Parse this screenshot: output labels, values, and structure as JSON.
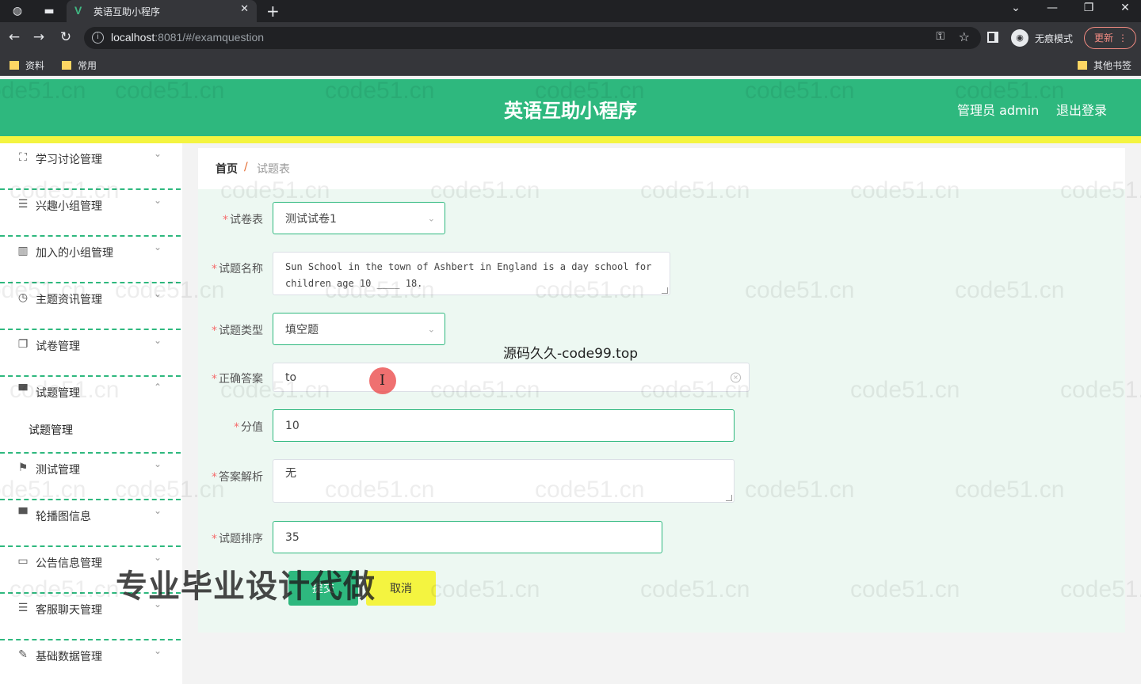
{
  "browser": {
    "tab_title": "英语互助小程序",
    "url_host": "localhost",
    "url_rest": ":8081/#/examquestion",
    "incognito_label": "无痕模式",
    "update_label": "更新",
    "bookmarks": [
      "资料",
      "常用"
    ],
    "other_bookmarks": "其他书签"
  },
  "header": {
    "title": "英语互助小程序",
    "admin": "管理员 admin",
    "logout": "退出登录"
  },
  "sidebar": {
    "items": [
      {
        "label": "学习讨论管理",
        "icon": "expand-icon"
      },
      {
        "label": "兴趣小组管理",
        "icon": "list-icon"
      },
      {
        "label": "加入的小组管理",
        "icon": "books-icon"
      },
      {
        "label": "主题资讯管理",
        "icon": "clock-icon"
      },
      {
        "label": "试卷管理",
        "icon": "copy-icon"
      },
      {
        "label": "试题管理",
        "icon": "monitor-icon"
      },
      {
        "label": "测试管理",
        "icon": "flag-icon"
      },
      {
        "label": "轮播图信息",
        "icon": "monitor-icon"
      },
      {
        "label": "公告信息管理",
        "icon": "message-icon"
      },
      {
        "label": "客服聊天管理",
        "icon": "list-icon"
      },
      {
        "label": "基础数据管理",
        "icon": "edit-icon"
      }
    ],
    "submenu": "试题管理"
  },
  "breadcrumb": {
    "home": "首页",
    "separator": "/",
    "current": "试题表"
  },
  "form": {
    "paper": {
      "label": "试卷表",
      "value": "测试试卷1"
    },
    "name": {
      "label": "试题名称",
      "line1": "Sun School in the town of Ashbert in England is a day school for",
      "line2": "children age 10 ____ 18."
    },
    "type": {
      "label": "试题类型",
      "value": "填空题"
    },
    "answer": {
      "label": "正确答案",
      "value": "to"
    },
    "score": {
      "label": "分值",
      "value": "10"
    },
    "analysis": {
      "label": "答案解析",
      "value": "无"
    },
    "order": {
      "label": "试题排序",
      "value": "35"
    },
    "submit": "提交",
    "cancel": "取消"
  },
  "overlays": {
    "source": "源码久久-code99.top",
    "promo": "专业毕业设计代做",
    "watermark": "code51.cn"
  },
  "colors": {
    "primary": "#2eb87e",
    "accent_yellow": "#f4f440",
    "required": "#f56c6c"
  }
}
